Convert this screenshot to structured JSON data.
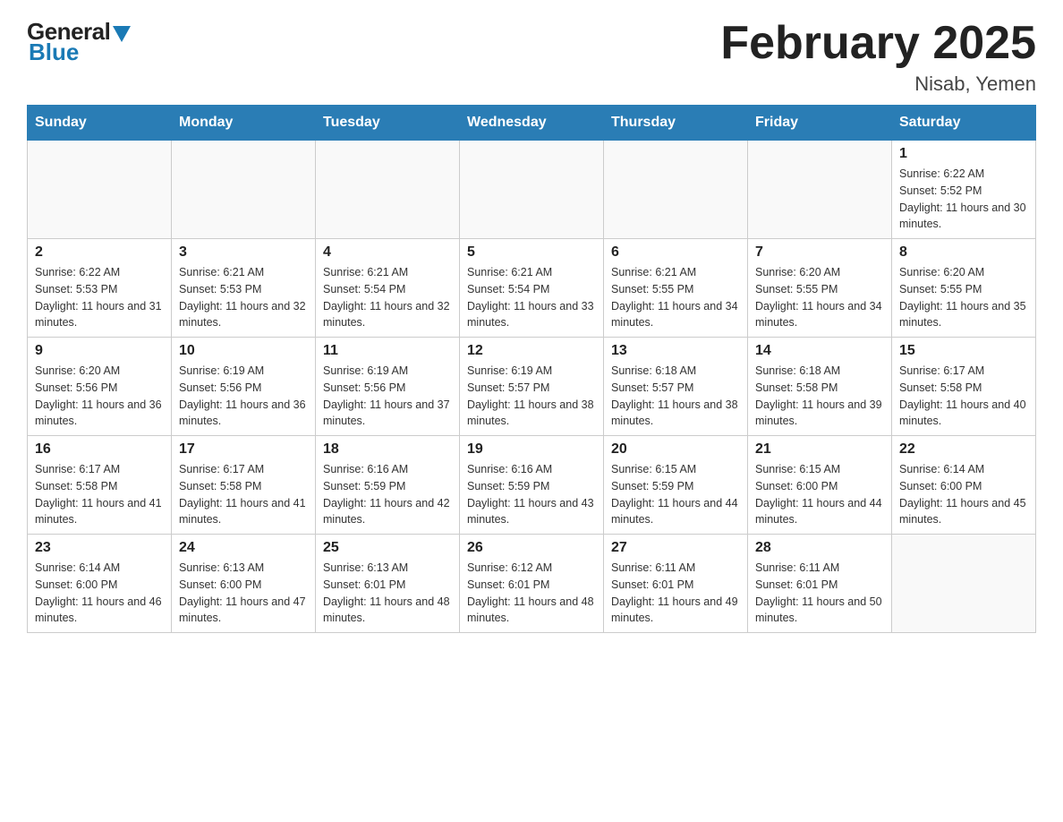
{
  "logo": {
    "general": "General",
    "blue": "Blue"
  },
  "header": {
    "title": "February 2025",
    "location": "Nisab, Yemen"
  },
  "weekdays": [
    "Sunday",
    "Monday",
    "Tuesday",
    "Wednesday",
    "Thursday",
    "Friday",
    "Saturday"
  ],
  "weeks": [
    [
      {
        "day": "",
        "info": ""
      },
      {
        "day": "",
        "info": ""
      },
      {
        "day": "",
        "info": ""
      },
      {
        "day": "",
        "info": ""
      },
      {
        "day": "",
        "info": ""
      },
      {
        "day": "",
        "info": ""
      },
      {
        "day": "1",
        "info": "Sunrise: 6:22 AM\nSunset: 5:52 PM\nDaylight: 11 hours and 30 minutes."
      }
    ],
    [
      {
        "day": "2",
        "info": "Sunrise: 6:22 AM\nSunset: 5:53 PM\nDaylight: 11 hours and 31 minutes."
      },
      {
        "day": "3",
        "info": "Sunrise: 6:21 AM\nSunset: 5:53 PM\nDaylight: 11 hours and 32 minutes."
      },
      {
        "day": "4",
        "info": "Sunrise: 6:21 AM\nSunset: 5:54 PM\nDaylight: 11 hours and 32 minutes."
      },
      {
        "day": "5",
        "info": "Sunrise: 6:21 AM\nSunset: 5:54 PM\nDaylight: 11 hours and 33 minutes."
      },
      {
        "day": "6",
        "info": "Sunrise: 6:21 AM\nSunset: 5:55 PM\nDaylight: 11 hours and 34 minutes."
      },
      {
        "day": "7",
        "info": "Sunrise: 6:20 AM\nSunset: 5:55 PM\nDaylight: 11 hours and 34 minutes."
      },
      {
        "day": "8",
        "info": "Sunrise: 6:20 AM\nSunset: 5:55 PM\nDaylight: 11 hours and 35 minutes."
      }
    ],
    [
      {
        "day": "9",
        "info": "Sunrise: 6:20 AM\nSunset: 5:56 PM\nDaylight: 11 hours and 36 minutes."
      },
      {
        "day": "10",
        "info": "Sunrise: 6:19 AM\nSunset: 5:56 PM\nDaylight: 11 hours and 36 minutes."
      },
      {
        "day": "11",
        "info": "Sunrise: 6:19 AM\nSunset: 5:56 PM\nDaylight: 11 hours and 37 minutes."
      },
      {
        "day": "12",
        "info": "Sunrise: 6:19 AM\nSunset: 5:57 PM\nDaylight: 11 hours and 38 minutes."
      },
      {
        "day": "13",
        "info": "Sunrise: 6:18 AM\nSunset: 5:57 PM\nDaylight: 11 hours and 38 minutes."
      },
      {
        "day": "14",
        "info": "Sunrise: 6:18 AM\nSunset: 5:58 PM\nDaylight: 11 hours and 39 minutes."
      },
      {
        "day": "15",
        "info": "Sunrise: 6:17 AM\nSunset: 5:58 PM\nDaylight: 11 hours and 40 minutes."
      }
    ],
    [
      {
        "day": "16",
        "info": "Sunrise: 6:17 AM\nSunset: 5:58 PM\nDaylight: 11 hours and 41 minutes."
      },
      {
        "day": "17",
        "info": "Sunrise: 6:17 AM\nSunset: 5:58 PM\nDaylight: 11 hours and 41 minutes."
      },
      {
        "day": "18",
        "info": "Sunrise: 6:16 AM\nSunset: 5:59 PM\nDaylight: 11 hours and 42 minutes."
      },
      {
        "day": "19",
        "info": "Sunrise: 6:16 AM\nSunset: 5:59 PM\nDaylight: 11 hours and 43 minutes."
      },
      {
        "day": "20",
        "info": "Sunrise: 6:15 AM\nSunset: 5:59 PM\nDaylight: 11 hours and 44 minutes."
      },
      {
        "day": "21",
        "info": "Sunrise: 6:15 AM\nSunset: 6:00 PM\nDaylight: 11 hours and 44 minutes."
      },
      {
        "day": "22",
        "info": "Sunrise: 6:14 AM\nSunset: 6:00 PM\nDaylight: 11 hours and 45 minutes."
      }
    ],
    [
      {
        "day": "23",
        "info": "Sunrise: 6:14 AM\nSunset: 6:00 PM\nDaylight: 11 hours and 46 minutes."
      },
      {
        "day": "24",
        "info": "Sunrise: 6:13 AM\nSunset: 6:00 PM\nDaylight: 11 hours and 47 minutes."
      },
      {
        "day": "25",
        "info": "Sunrise: 6:13 AM\nSunset: 6:01 PM\nDaylight: 11 hours and 48 minutes."
      },
      {
        "day": "26",
        "info": "Sunrise: 6:12 AM\nSunset: 6:01 PM\nDaylight: 11 hours and 48 minutes."
      },
      {
        "day": "27",
        "info": "Sunrise: 6:11 AM\nSunset: 6:01 PM\nDaylight: 11 hours and 49 minutes."
      },
      {
        "day": "28",
        "info": "Sunrise: 6:11 AM\nSunset: 6:01 PM\nDaylight: 11 hours and 50 minutes."
      },
      {
        "day": "",
        "info": ""
      }
    ]
  ]
}
